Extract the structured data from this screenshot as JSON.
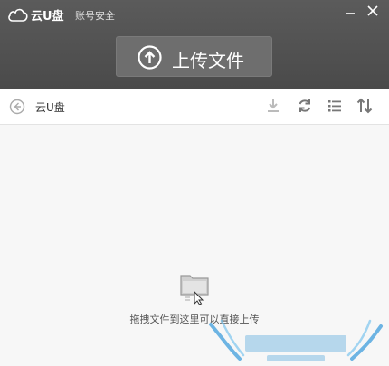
{
  "titlebar": {
    "app_name": "云U盘",
    "account_link": "账号安全"
  },
  "upload_button": {
    "label": "上传文件"
  },
  "toolbar": {
    "breadcrumb": "云U盘"
  },
  "dropzone": {
    "hint": "拖拽文件到这里可以直接上传"
  },
  "colors": {
    "titlebar": "#555555",
    "upload_bg": "#6e6e6e",
    "icon_gray": "#888888"
  }
}
